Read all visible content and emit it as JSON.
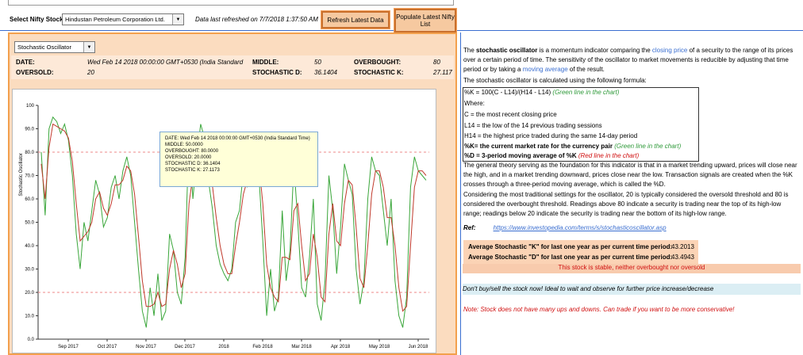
{
  "header": {
    "select_label": "Select Nifty Stock:",
    "stock_value": "Hindustan Petroleum Corporation Ltd.",
    "refresh_text": "Data last refreshed on 7/7/2018 1:37:50 AM",
    "refresh_button": "Refresh Latest Data",
    "populate_button": "Populate Latest Nifty List"
  },
  "indicator": {
    "value": "Stochastic Oscillator"
  },
  "stats": {
    "date_label": "DATE:",
    "date_value": "Wed Feb 14 2018 00:00:00 GMT+0530 (India Standard Time)",
    "middle_label": "MIDDLE:",
    "middle_value": "50",
    "overbought_label": "OVERBOUGHT:",
    "overbought_value": "80",
    "oversold_label": "OVERSOLD:",
    "oversold_value": "20",
    "stochd_label": "STOCHASTIC D:",
    "stochd_value": "36.1404",
    "stochk_label": "STOCHASTIC K:",
    "stochk_value": "27.117"
  },
  "tooltip": {
    "line1": "DATE: Wed Feb 14 2018 00:00:00 GMT+0530 (India Standard Time)",
    "line2": "MIDDLE: 50.0000",
    "line3": "OVERBOUGHT: 80.0000",
    "line4": "OVERSOLD: 20.0000",
    "line5": "STOCHASTIC D: 36.1404",
    "line6": "STOCHASTIC K: 27.1173"
  },
  "chart_data": {
    "type": "line",
    "ylabel": "Stochastic Oscillator",
    "ylim": [
      0,
      100
    ],
    "yticks": [
      "0.0",
      "10.0",
      "20.0",
      "30.0",
      "40.0",
      "50.0",
      "60.0",
      "70.0",
      "80.0",
      "90.0",
      "100"
    ],
    "xticks": [
      "Sep 2017",
      "Oct 2017",
      "Nov 2017",
      "Dec 2017",
      "2018",
      "Feb 2018",
      "Mar 2018",
      "Apr 2018",
      "May 2018",
      "Jun 2018"
    ],
    "reference_lines": [
      80,
      20
    ],
    "series": [
      {
        "color": "#3aa63a",
        "values": [
          80,
          53,
          90,
          95,
          93,
          88,
          92,
          85,
          70,
          45,
          30,
          50,
          42,
          55,
          68,
          62,
          48,
          52,
          65,
          70,
          60,
          72,
          78,
          70,
          50,
          30,
          12,
          5,
          22,
          10,
          28,
          8,
          12,
          45,
          38,
          20,
          15,
          35,
          88,
          60,
          78,
          92,
          86,
          68,
          56,
          40,
          32,
          28,
          25,
          30,
          50,
          55,
          72,
          65,
          78,
          80,
          70,
          42,
          10,
          30,
          12,
          18,
          55,
          25,
          38,
          75,
          50,
          22,
          18,
          35,
          60,
          15,
          8,
          25,
          70,
          55,
          28,
          48,
          75,
          68,
          62,
          30,
          15,
          25,
          60,
          78,
          72,
          70,
          55,
          40,
          60,
          25,
          10,
          5,
          18,
          65,
          78,
          72,
          70,
          68
        ]
      },
      {
        "color": "#c0392b",
        "values": [
          75,
          60,
          82,
          92,
          91,
          90,
          89,
          86,
          76,
          58,
          42,
          44,
          46,
          50,
          60,
          63,
          56,
          53,
          58,
          66,
          66,
          68,
          74,
          72,
          62,
          44,
          25,
          14,
          14,
          15,
          20,
          14,
          15,
          30,
          38,
          32,
          22,
          28,
          58,
          70,
          72,
          84,
          86,
          80,
          66,
          52,
          40,
          32,
          28,
          28,
          40,
          50,
          62,
          68,
          72,
          78,
          75,
          58,
          32,
          22,
          18,
          16,
          35,
          35,
          34,
          55,
          58,
          40,
          25,
          28,
          45,
          35,
          18,
          16,
          45,
          58,
          42,
          40,
          58,
          68,
          66,
          48,
          26,
          22,
          40,
          62,
          72,
          72,
          65,
          52,
          52,
          40,
          22,
          12,
          14,
          40,
          65,
          72,
          72,
          70
        ]
      }
    ]
  },
  "right": {
    "p1_a": "The ",
    "p1_b": "stochastic oscillator",
    "p1_c": " is a momentum indicator comparing the ",
    "p1_link1": "closing price",
    "p1_d": " of a security to the range of its prices over a certain period of time. The sensitivity of the oscillator to market movements is reducible by adjusting that time period or by taking a ",
    "p1_link2": "moving average",
    "p1_e": " of the result.",
    "p2": "The stochastic oscillator is calculated using the following formula:",
    "f1": "%K = 100(C - L14)/(H14 - L14)",
    "f1_note": "(Green line in the chart)",
    "f2": "Where:",
    "f3": "C = the most recent closing price",
    "f4": "L14 = the low of the 14 previous trading sessions",
    "f5": "H14 = the highest price traded during the same 14-day period",
    "f6": "%K= the current market rate for the currency pair",
    "f6_note": "(Green line in the chart)",
    "f7": "%D = 3-period moving average of %K",
    "f7_note": "(Red line in the chart)",
    "p3": "The general theory serving as the foundation for this indicator is that in a market trending upward, prices will close near the high, and in a market trending downward, prices close near the low. Transaction signals are created when the %K crosses through a three-period moving average, which is called the %D.",
    "p4": "Considering the most traditional settings for the oscillator, 20 is typically considered the oversold threshold and 80 is considered the overbought threshold. Readings above 80 indicate a security is trading near the top of its high-low range; readings below 20 indicate the security is trading near the bottom of its high-low range.",
    "ref_label": "Ref:",
    "ref_link": "https://www.investopedia.com/terms/s/stochasticoscillator.asp",
    "avg_k_label": "Average Stochastic \"K\" for last one year as per current time period:",
    "avg_k_value": "43.2013",
    "avg_d_label": "Average Stochastic \"D\" for last one year as per current time period:",
    "avg_d_value": "43.4943",
    "stable": "This stock is stable, neither overbought nor oversold",
    "advice": "Don't buy/sell the stock now! Ideal to wait and observe for further price increase/decrease",
    "note": "Note: Stock does not have many ups and downs. Can trade if you want to be more conservative!"
  }
}
